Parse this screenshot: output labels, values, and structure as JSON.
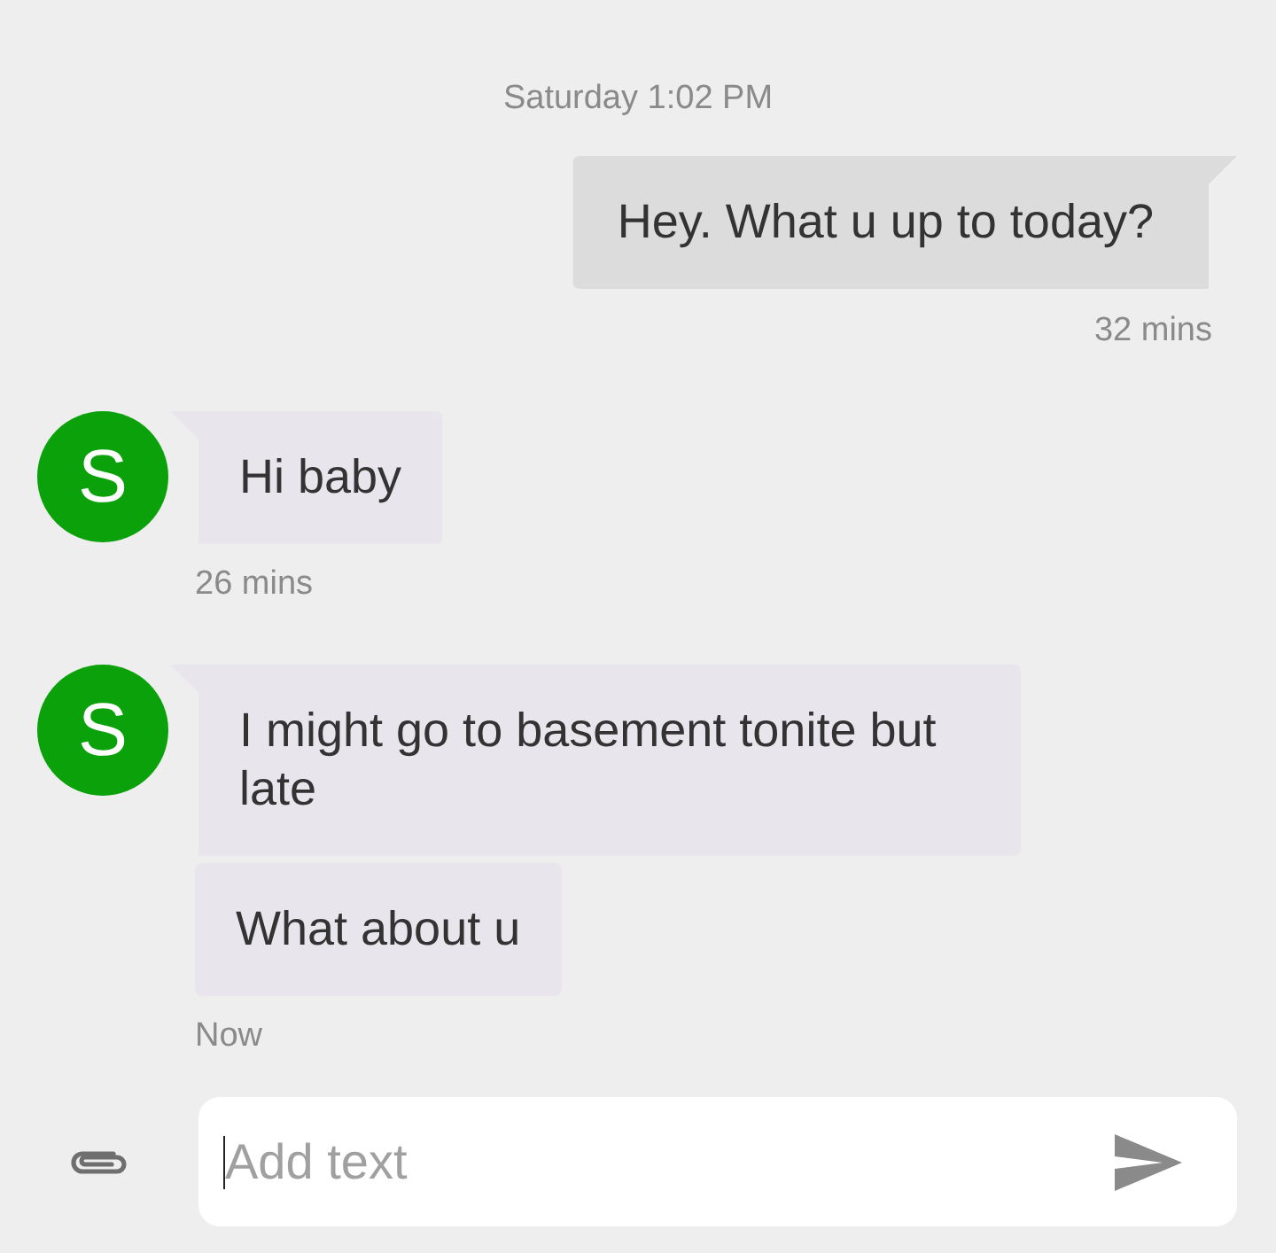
{
  "timestamp": "Saturday 1:02 PM",
  "groups": [
    {
      "kind": "outgoing",
      "bubbles": [
        "Hey. What u up to today?"
      ],
      "time": "32 mins"
    },
    {
      "kind": "incoming",
      "avatar": "S",
      "bubbles": [
        "Hi baby"
      ],
      "time": "26 mins"
    },
    {
      "kind": "incoming",
      "avatar": "S",
      "bubbles": [
        "I might go to basement tonite but late",
        "What about u"
      ],
      "time": "Now"
    }
  ],
  "composer": {
    "placeholder": "Add text"
  }
}
